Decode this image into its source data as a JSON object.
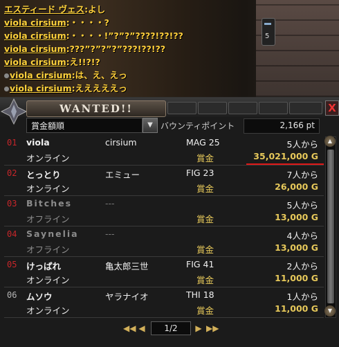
{
  "chat": [
    {
      "name": "エスティード ヴェス",
      "message": ":よし",
      "bullet": false
    },
    {
      "name": "viola cirsium",
      "message": ":・・・・?",
      "bullet": false
    },
    {
      "name": "viola cirsium",
      "message": ":・・・・!”?”?”????!??!??",
      "bullet": false
    },
    {
      "name": "viola cirsium",
      "message": ":???”?”?”?”???!??!??",
      "bullet": false
    },
    {
      "name": "viola cirsium",
      "message": ":え!!?!?",
      "bullet": false
    },
    {
      "name": "viola cirsium",
      "message": ":は、え、えっ",
      "bullet": true
    },
    {
      "name": "viola cirsium",
      "message": ":えええええっ",
      "bullet": true
    }
  ],
  "side_handle": {
    "number": "5"
  },
  "window": {
    "title": "WANTED!!",
    "close_label": "X"
  },
  "sort": {
    "selected": "賞金額順",
    "arrow": "▼"
  },
  "bounty_points": {
    "label": "バウンティポイント",
    "value": "2,166 pt"
  },
  "bounty_label": "賞金",
  "rows": [
    {
      "rank": "01",
      "rank_color": "red",
      "name": "viola",
      "guild": "cirsium",
      "class": "MAG 25",
      "status": "オンライン",
      "count": "5人から",
      "bounty": "35,021,000 G",
      "online": true
    },
    {
      "rank": "02",
      "rank_color": "red",
      "name": "とっとり",
      "guild": "エミュー",
      "class": "FIG 23",
      "status": "オンライン",
      "count": "7人から",
      "bounty": "26,000 G",
      "online": true
    },
    {
      "rank": "03",
      "rank_color": "red",
      "name": "Bitches",
      "guild": "---",
      "class": "",
      "status": "オフライン",
      "count": "5人から",
      "bounty": "13,000 G",
      "online": false
    },
    {
      "rank": "04",
      "rank_color": "red",
      "name": "Saynelia",
      "guild": "---",
      "class": "",
      "status": "オフライン",
      "count": "4人から",
      "bounty": "13,000 G",
      "online": false
    },
    {
      "rank": "05",
      "rank_color": "red",
      "name": "けっぱれ",
      "guild": "亀太郎三世",
      "class": "FIG 41",
      "status": "オンライン",
      "count": "2人から",
      "bounty": "11,000 G",
      "online": true
    },
    {
      "rank": "06",
      "rank_color": "grey",
      "name": "ムソウ",
      "guild": "ヤラナイオ",
      "class": "THI 18",
      "status": "オンライン",
      "count": "1人から",
      "bounty": "11,000 G",
      "online": true
    }
  ],
  "pager": {
    "label": "1/2",
    "first": "◀◀",
    "prev": "◀",
    "next": "▶",
    "last": "▶▶"
  },
  "colors": {
    "highlight_line": "#e01818",
    "bounty_text": "#e6c85a",
    "chat_text": "#ffd23c"
  }
}
